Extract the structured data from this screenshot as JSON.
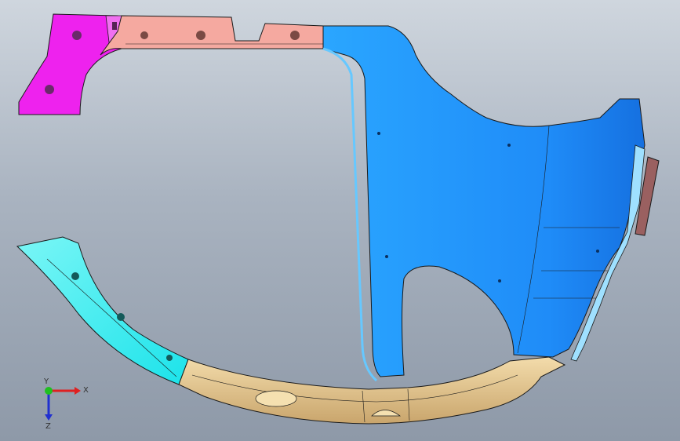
{
  "viewport": {
    "colors": {
      "pink_part": "#f5a9a0",
      "magenta_part": "#ee22ee",
      "blue_part": "#1e8fff",
      "light_blue_edge": "#66c8ff",
      "cyan_part": "#20f0f0",
      "tan_part": "#e8c890",
      "edge_lines": "#1a1a1a"
    }
  },
  "triad": {
    "x_label": "X",
    "y_label": "Y",
    "z_label": "Z"
  }
}
